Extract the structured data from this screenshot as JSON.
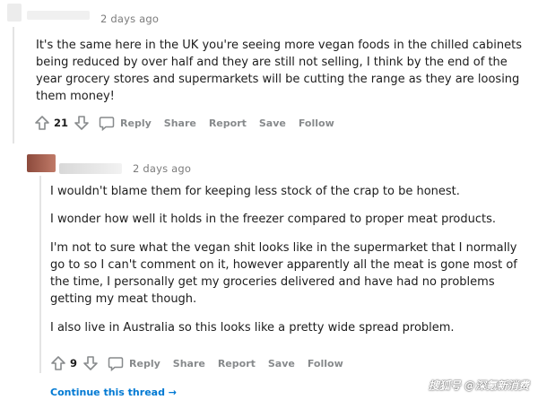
{
  "comments": [
    {
      "timestamp": "2 days ago",
      "body": [
        "It's the same here in the UK you're seeing more vegan foods in the chilled cabinets being reduced by over half and they are still not selling, I think by the end of the year grocery stores and supermarkets will be cutting the range as they are loosing them money!"
      ],
      "score": "21",
      "actions": {
        "reply": "Reply",
        "share": "Share",
        "report": "Report",
        "save": "Save",
        "follow": "Follow"
      }
    },
    {
      "timestamp": "2 days ago",
      "body": [
        "I wouldn't blame them for keeping less stock of the crap to be honest.",
        "I wonder how well it holds in the freezer compared to proper meat products.",
        "I'm not to sure what the vegan shit looks like in the supermarket that I normally go to so I can't comment on it, however apparently all the meat is gone most of the time, I personally get my groceries delivered and have had no problems getting my meat though.",
        "I also live in Australia so this looks like a pretty wide spread problem."
      ],
      "score": "9",
      "actions": {
        "reply": "Reply",
        "share": "Share",
        "report": "Report",
        "save": "Save",
        "follow": "Follow"
      }
    }
  ],
  "continue_thread": "Continue this thread →",
  "watermark": "搜狐号 @深氪新消费",
  "colors": {
    "link": "#0079d3",
    "meta": "#7c7c7c",
    "action": "#878a8c",
    "thread_line": "#e4e4e4"
  },
  "icons": [
    "upvote-icon",
    "downvote-icon",
    "comment-bubble-icon"
  ]
}
